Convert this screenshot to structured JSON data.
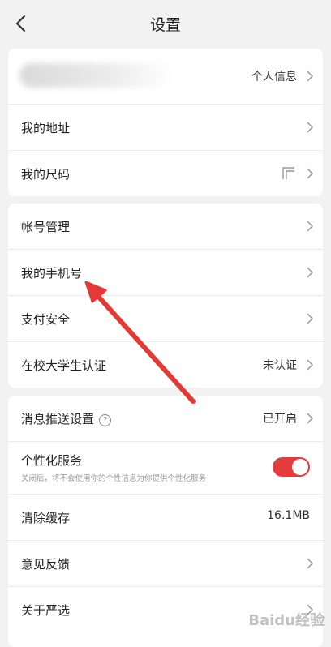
{
  "header": {
    "title": "设置"
  },
  "group1": {
    "profile_label": "个人信息",
    "address_label": "我的地址",
    "size_label": "我的尺码"
  },
  "group2": {
    "account_label": "帐号管理",
    "phone_label": "我的手机号",
    "payment_label": "支付安全",
    "student_label": "在校大学生认证",
    "student_value": "未认证"
  },
  "group3": {
    "push_label": "消息推送设置",
    "push_help": "?",
    "push_value": "已开启",
    "personal_label": "个性化服务",
    "personal_sub": "关闭后，将不会使用你的个性信息为你提供个性化服务",
    "personal_on": true,
    "cache_label": "清除缓存",
    "cache_value": "16.1MB",
    "feedback_label": "意见反馈",
    "about_label": "关于严选"
  },
  "watermark": "Baidu经验",
  "colors": {
    "toggle_on": "#e43b3d",
    "arrow": "#e53935"
  },
  "icons": [
    "back-arrow-icon",
    "chevron-right-icon",
    "qr-code-icon",
    "help-circle-icon"
  ]
}
